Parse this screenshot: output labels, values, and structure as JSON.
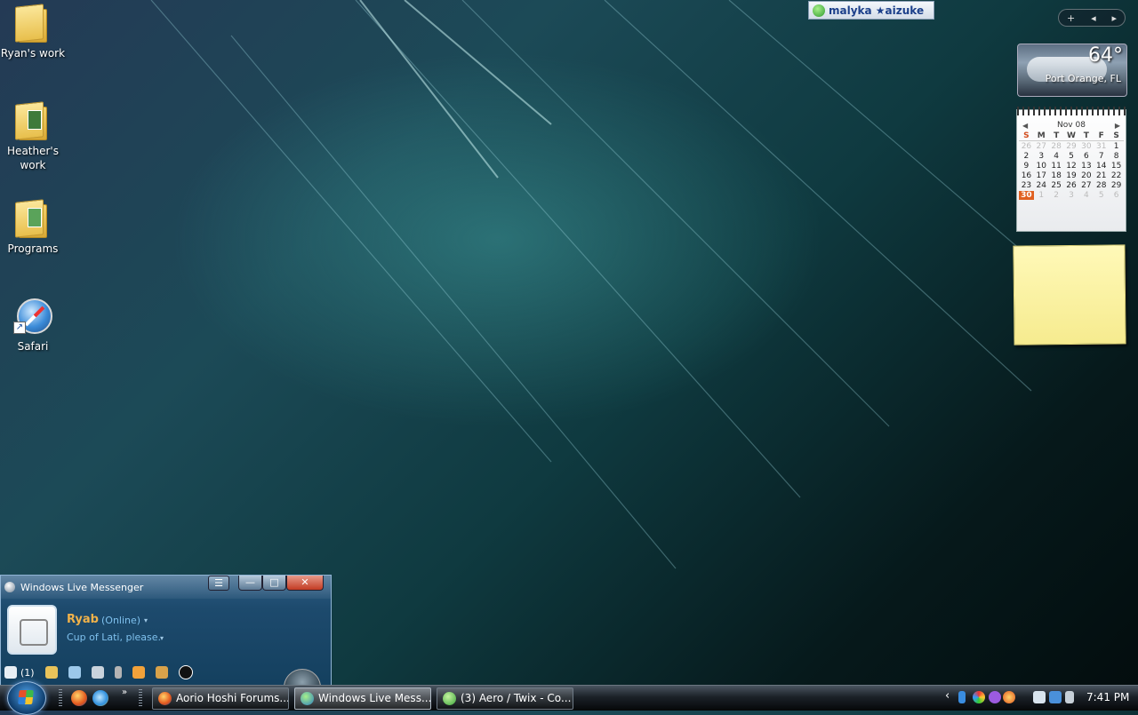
{
  "desktop": {
    "icons": [
      {
        "label": "Ryan's work"
      },
      {
        "label": "Heather's work"
      },
      {
        "label": "Programs"
      },
      {
        "label": "Safari"
      }
    ]
  },
  "contact_notification": {
    "name": "malyka ★aizuke"
  },
  "sidebar": {
    "toolbar": {
      "add": "+",
      "prev": "◂",
      "next": "▸"
    },
    "weather": {
      "temperature": "64°",
      "location": "Port Orange, FL"
    },
    "calendar": {
      "month": "Nov 08",
      "prev": "◀",
      "next": "▶",
      "weekdays": [
        "S",
        "M",
        "T",
        "W",
        "T",
        "F",
        "S"
      ],
      "rows": [
        [
          "26",
          "27",
          "28",
          "29",
          "30",
          "31",
          "1"
        ],
        [
          "2",
          "3",
          "4",
          "5",
          "6",
          "7",
          "8"
        ],
        [
          "9",
          "10",
          "11",
          "12",
          "13",
          "14",
          "15"
        ],
        [
          "16",
          "17",
          "18",
          "19",
          "20",
          "21",
          "22"
        ],
        [
          "23",
          "24",
          "25",
          "26",
          "27",
          "28",
          "29"
        ],
        [
          "30",
          "1",
          "2",
          "3",
          "4",
          "5",
          "6"
        ]
      ],
      "today": "30"
    }
  },
  "messenger": {
    "title": "Windows Live Messenger",
    "controls": {
      "menu": "☰",
      "minimize": "—",
      "maximize": "□",
      "close": "✕"
    },
    "display_name": "Ryab",
    "status": "(Online)",
    "personal_message": "Cup of Lati, please.",
    "dropdown": "▾",
    "mail_count": "(1)"
  },
  "taskbar": {
    "quick_launch_more": "»",
    "tasks": [
      {
        "label": "Aorio Hoshi Forums...",
        "active": false
      },
      {
        "label": "Windows Live Mess...",
        "active": true
      },
      {
        "label": "(3) Aero / Twix - Co...",
        "active": false
      }
    ],
    "tray_arrow": "‹",
    "clock": "7:41 PM"
  },
  "colors": {
    "accent_orange": "#e06020",
    "messenger_name": "#f0b24a",
    "messenger_text": "#7fc1ee"
  }
}
